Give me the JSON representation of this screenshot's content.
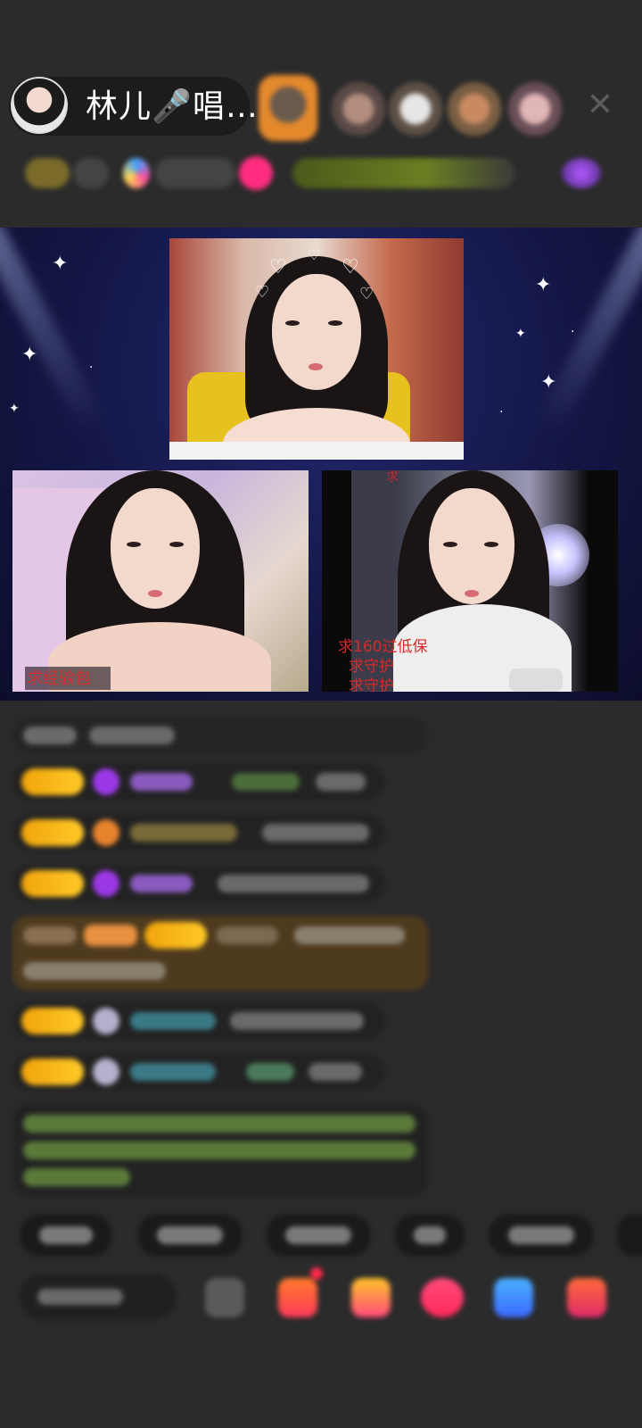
{
  "header": {
    "host_name": "林儿🎤唱…",
    "close_symbol": "✕"
  },
  "stage": {
    "left_cam_caption": "求经验包",
    "right_cam_lines": [
      "求160过低保",
      "求守护",
      "求守护"
    ]
  },
  "colors": {
    "background": "#2b2b2b",
    "badge_gold": "#f0a40b",
    "stage_bg": "#141746",
    "gem_purple": "#9b38e6",
    "caption_red": "#d62b2b"
  },
  "icons": [
    "avatar",
    "close-icon",
    "gem-icon",
    "gift-icon",
    "more-icon"
  ]
}
